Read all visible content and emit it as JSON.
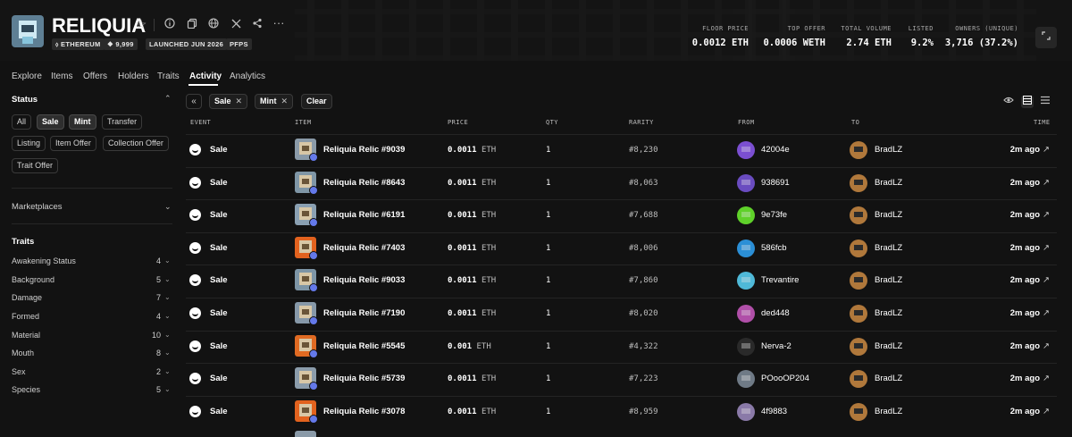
{
  "collection": {
    "name": "RELIQUIA",
    "badges": [
      "⬨ ETHEREUM",
      "❖ 9,999",
      "LAUNCHED JUN 2026",
      "PFPS"
    ],
    "header_icons": [
      "star-icon",
      "info-icon",
      "copy-icon",
      "globe-icon",
      "x-icon",
      "share-icon",
      "more-icon"
    ],
    "stats": [
      {
        "label": "FLOOR PRICE",
        "value": "0.0012 ETH"
      },
      {
        "label": "TOP OFFER",
        "value": "0.0006 WETH"
      },
      {
        "label": "TOTAL VOLUME",
        "value": "2.74 ETH"
      },
      {
        "label": "LISTED",
        "value": "9.2%"
      },
      {
        "label": "OWNERS (UNIQUE)",
        "value": "3,716 (37.2%)"
      }
    ]
  },
  "tabs": [
    "Explore",
    "Items",
    "Offers",
    "Holders",
    "Traits",
    "Activity",
    "Analytics"
  ],
  "active_tab": "Activity",
  "sidebar": {
    "status_title": "Status",
    "status_chips": [
      {
        "label": "All",
        "selected": false
      },
      {
        "label": "Sale",
        "selected": true
      },
      {
        "label": "Mint",
        "selected": true
      },
      {
        "label": "Transfer",
        "selected": false
      },
      {
        "label": "Listing",
        "selected": false
      },
      {
        "label": "Item Offer",
        "selected": false
      },
      {
        "label": "Collection Offer",
        "selected": false
      },
      {
        "label": "Trait Offer",
        "selected": false
      }
    ],
    "marketplaces_title": "Marketplaces",
    "traits_title": "Traits",
    "traits": [
      {
        "name": "Awakening Status",
        "count": "4"
      },
      {
        "name": "Background",
        "count": "5"
      },
      {
        "name": "Damage",
        "count": "7"
      },
      {
        "name": "Formed",
        "count": "4"
      },
      {
        "name": "Material",
        "count": "10"
      },
      {
        "name": "Mouth",
        "count": "8"
      },
      {
        "name": "Sex",
        "count": "2"
      },
      {
        "name": "Species",
        "count": "5"
      }
    ]
  },
  "filters": {
    "active": [
      "Sale",
      "Mint"
    ],
    "clear_label": "Clear"
  },
  "table": {
    "headers": {
      "event": "EVENT",
      "item": "ITEM",
      "price": "PRICE",
      "qty": "QTY",
      "rarity": "RARITY",
      "from": "FROM",
      "to": "TO",
      "time": "TIME"
    },
    "rows": [
      {
        "event": "Sale",
        "item": "Reliquia Relic #9039",
        "price": "0.0011",
        "currency": "ETH",
        "qty": "1",
        "rarity": "#8,230",
        "from": "42004e",
        "to": "BradLZ",
        "time": "2m ago",
        "thumb_bg": "#8a9aa8",
        "from_color": "#7b4fd1"
      },
      {
        "event": "Sale",
        "item": "Reliquia Relic #8643",
        "price": "0.0011",
        "currency": "ETH",
        "qty": "1",
        "rarity": "#8,063",
        "from": "938691",
        "to": "BradLZ",
        "time": "2m ago",
        "thumb_bg": "#7f96a6",
        "from_color": "#6a4cc0"
      },
      {
        "event": "Sale",
        "item": "Reliquia Relic #6191",
        "price": "0.0011",
        "currency": "ETH",
        "qty": "1",
        "rarity": "#7,688",
        "from": "9e73fe",
        "to": "BradLZ",
        "time": "2m ago",
        "thumb_bg": "#8aa0b2",
        "from_color": "#5fd12a"
      },
      {
        "event": "Sale",
        "item": "Reliquia Relic #7403",
        "price": "0.0011",
        "currency": "ETH",
        "qty": "1",
        "rarity": "#8,006",
        "from": "586fcb",
        "to": "BradLZ",
        "time": "2m ago",
        "thumb_bg": "#e2621e",
        "from_color": "#2b8fd6"
      },
      {
        "event": "Sale",
        "item": "Reliquia Relic #9033",
        "price": "0.0011",
        "currency": "ETH",
        "qty": "1",
        "rarity": "#7,860",
        "from": "Trevantire",
        "to": "BradLZ",
        "time": "2m ago",
        "thumb_bg": "#7d95a6",
        "from_color": "#4fb9d8"
      },
      {
        "event": "Sale",
        "item": "Reliquia Relic #7190",
        "price": "0.0011",
        "currency": "ETH",
        "qty": "1",
        "rarity": "#8,020",
        "from": "ded448",
        "to": "BradLZ",
        "time": "2m ago",
        "thumb_bg": "#8698a8",
        "from_color": "#b04fa8"
      },
      {
        "event": "Sale",
        "item": "Reliquia Relic #5545",
        "price": "0.001",
        "currency": "ETH",
        "qty": "1",
        "rarity": "#4,322",
        "from": "Nerva-2",
        "to": "BradLZ",
        "time": "2m ago",
        "thumb_bg": "#e06a22",
        "from_color": "#2a2a2a"
      },
      {
        "event": "Sale",
        "item": "Reliquia Relic #5739",
        "price": "0.0011",
        "currency": "ETH",
        "qty": "1",
        "rarity": "#7,223",
        "from": "POooOP204",
        "to": "BradLZ",
        "time": "2m ago",
        "thumb_bg": "#8b9cab",
        "from_color": "#6f7a86"
      },
      {
        "event": "Sale",
        "item": "Reliquia Relic #3078",
        "price": "0.0011",
        "currency": "ETH",
        "qty": "1",
        "rarity": "#8,959",
        "from": "4f9883",
        "to": "BradLZ",
        "time": "2m ago",
        "thumb_bg": "#e2621e",
        "from_color": "#8a7aa8"
      }
    ]
  },
  "colors": {
    "background": "#121212",
    "accent": "#6479ea"
  }
}
